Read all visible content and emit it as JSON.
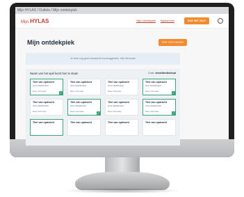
{
  "breadcrumb": "Mijn HYLAS / Outlets / Mijn ontdekpiek",
  "logo": {
    "prefix": "Mijn",
    "brand": "HYLAS"
  },
  "nav": {
    "item1": "Mijn ontdekpiek",
    "item2": "Bijdrachten"
  },
  "header_button": "DOE HET ZELF",
  "page": {
    "title": "Mijn ontdekpiek",
    "button": "EEN TOEVOEGEN"
  },
  "empty_text": "Je hebt nog geen bewaarde invulsuggesties. Klik hieronder",
  "panel": {
    "heading": "Naam van het spel komt hier te staan",
    "code_label": "Code:",
    "code": "bestelbestbekopt"
  },
  "cards": [
    {
      "title": "Titel van opdracht",
      "meta": "2016 ZEKERHEID",
      "link": "Meer informatie",
      "selected": true
    },
    {
      "title": "Titel van opdracht",
      "meta": "2016 ZEKERHEID",
      "link": "Meer informatie",
      "selected": false
    },
    {
      "title": "Titel van opdracht",
      "meta": "2016 ZEKERHEID",
      "link": "Meer informatie",
      "selected": false
    },
    {
      "title": "Titel van opdracht",
      "meta": "2016 ZEKERHEID",
      "link": "Meer informatie",
      "selected": true
    },
    {
      "title": "Titel van opdracht",
      "meta": "2016 ZEKERHEID",
      "link": "Meer informatie",
      "selected": false
    },
    {
      "title": "Titel van opdracht",
      "meta": "2016 ZEKERHEID",
      "link": "Meer informatie",
      "selected": true
    },
    {
      "title": "Titel van opdracht",
      "meta": "2016 ZEKERHEID",
      "link": "Meer informatie",
      "selected": false
    },
    {
      "title": "Titel van opdracht",
      "meta": "2016 ZEKERHEID",
      "link": "Meer informatie",
      "selected": true
    },
    {
      "title": "Titel van opdracht",
      "meta": "",
      "link": "",
      "selected": true
    },
    {
      "title": "Titel van opdracht",
      "meta": "",
      "link": "",
      "selected": false
    },
    {
      "title": "Titel van opdracht",
      "meta": "",
      "link": "",
      "selected": false
    },
    {
      "title": "Titel van opdracht",
      "meta": "",
      "link": "",
      "selected": false
    }
  ],
  "colors": {
    "accent": "#f28a2e",
    "brand": "#c0392b",
    "selected": "#3aa37a"
  }
}
